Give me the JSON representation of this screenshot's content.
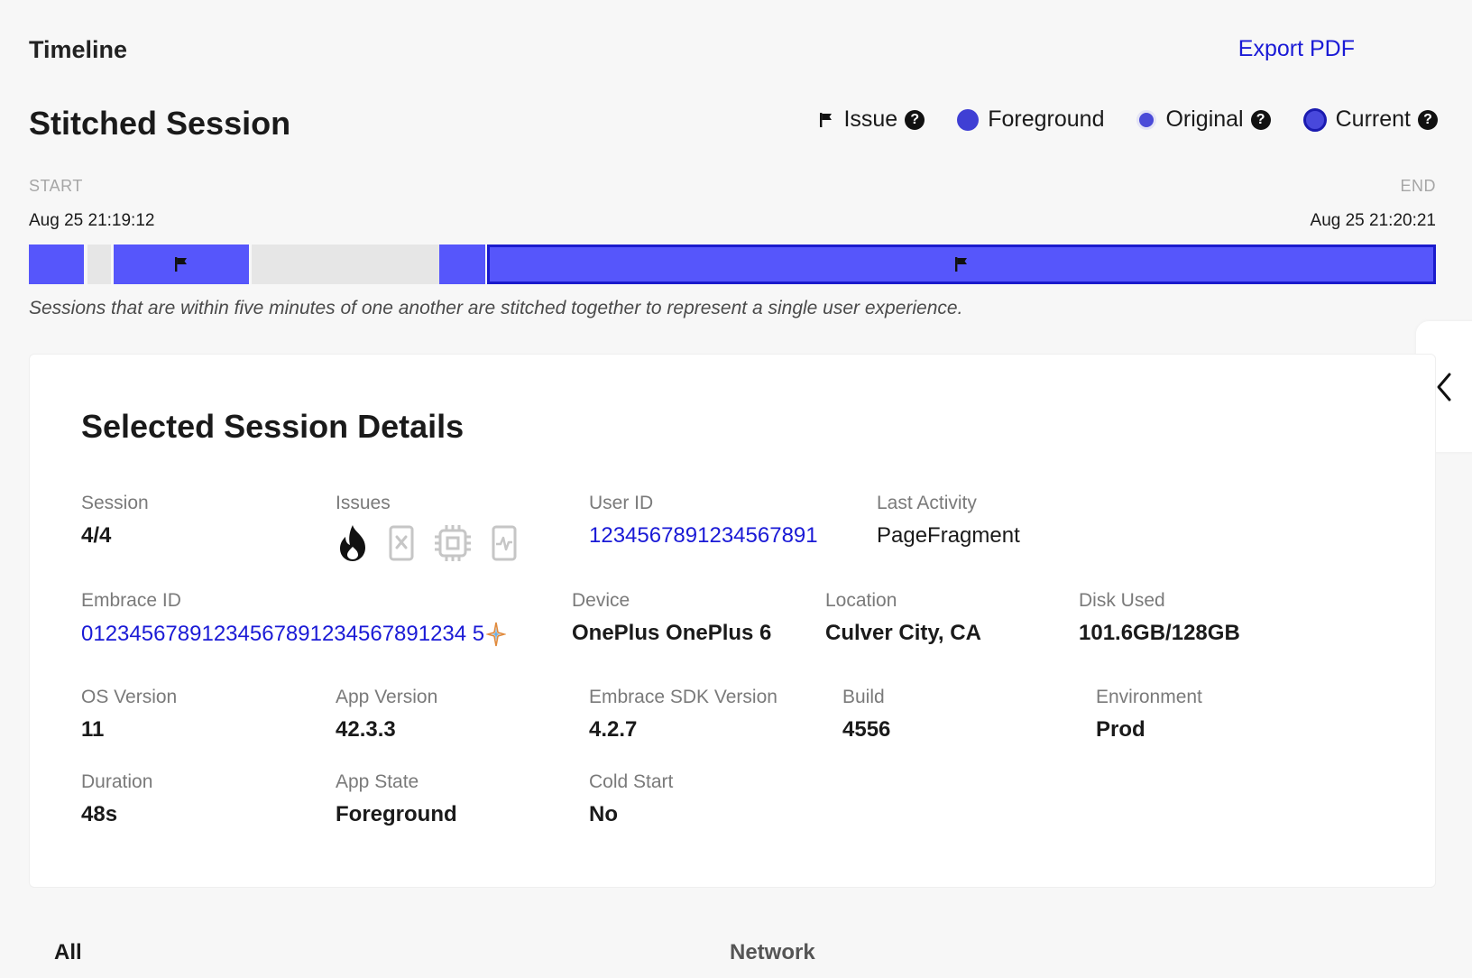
{
  "header": {
    "section_label": "Timeline",
    "export_label": "Export PDF",
    "session_title": "Stitched Session"
  },
  "legend": {
    "issue": "Issue",
    "foreground": "Foreground",
    "original": "Original",
    "current": "Current",
    "help_glyph": "?"
  },
  "timeline": {
    "start_label": "START",
    "end_label": "END",
    "start_time": "Aug 25 21:19:12",
    "end_time": "Aug 25 21:20:21",
    "note": "Sessions that are within five minutes of one another are stitched together to represent a single user experience."
  },
  "details": {
    "title": "Selected Session Details",
    "session": {
      "label": "Session",
      "value": "4/4"
    },
    "issues": {
      "label": "Issues",
      "icons": [
        "crash-flame-icon",
        "anr-icon",
        "memory-chip-icon",
        "network-pulse-icon"
      ]
    },
    "user_id": {
      "label": "User ID",
      "value": "1234567891234567891"
    },
    "last_activity": {
      "label": "Last Activity",
      "value": "PageFragment"
    },
    "embrace_id": {
      "label": "Embrace ID",
      "value": "01234567891234567891234567891234 5"
    },
    "device": {
      "label": "Device",
      "value": "OnePlus OnePlus 6"
    },
    "location": {
      "label": "Location",
      "value": "Culver City, CA"
    },
    "disk_used": {
      "label": "Disk Used",
      "value": "101.6GB/128GB"
    },
    "os_version": {
      "label": "OS Version",
      "value": "11"
    },
    "app_version": {
      "label": "App Version",
      "value": "42.3.3"
    },
    "sdk_version": {
      "label": "Embrace SDK Version",
      "value": "4.2.7"
    },
    "build": {
      "label": "Build",
      "value": "4556"
    },
    "environment": {
      "label": "Environment",
      "value": "Prod"
    },
    "duration": {
      "label": "Duration",
      "value": "48s"
    },
    "app_state": {
      "label": "App State",
      "value": "Foreground"
    },
    "cold_start": {
      "label": "Cold Start",
      "value": "No"
    }
  },
  "tabs": {
    "all": "All",
    "network": "Network"
  },
  "colors": {
    "accent_link": "#1a1ad6",
    "segment_fill": "#5656fb",
    "current_border": "#1b1bcc",
    "gap_fill": "#e6e6e6"
  }
}
